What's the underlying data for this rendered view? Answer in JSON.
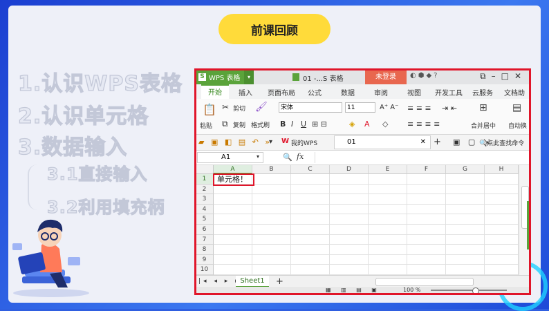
{
  "slide": {
    "title": "前课回顾",
    "outline": [
      "1.认识WPS表格",
      "2.认识单元格",
      "3.数据输入",
      "3.1直接输入",
      "3.2利用填充柄"
    ]
  },
  "colors": {
    "accent": "#ffdb3a",
    "highlight": "#e0152a",
    "wps_green": "#5aa33a"
  },
  "app": {
    "brand": "WPS 表格",
    "doc_title": "01 -...S 表格",
    "login": "未登录",
    "ribbon_tabs": [
      "开始",
      "插入",
      "页面布局",
      "公式",
      "数据",
      "审阅",
      "视图",
      "开发工具",
      "云服务",
      "文档助"
    ],
    "ribbon": {
      "paste": "粘贴",
      "cut": "剪切",
      "copy": "复制",
      "format_painter": "格式刷",
      "font": "宋体",
      "size": "11",
      "merge": "合并居中",
      "autowrap": "自动换"
    },
    "quickbar": {
      "my_wps": "我的WPS",
      "doc_tab": "01",
      "search": "点此查找命令"
    },
    "formula": {
      "name_box": "A1",
      "fx": "fx"
    },
    "columns": [
      "A",
      "B",
      "C",
      "D",
      "E",
      "F",
      "G",
      "H"
    ],
    "rows": [
      "1",
      "2",
      "3",
      "4",
      "5",
      "6",
      "7",
      "8",
      "9",
      "10"
    ],
    "cell_a1": "单元格！",
    "sheet_tab": "Sheet1",
    "zoom": "100 %"
  }
}
